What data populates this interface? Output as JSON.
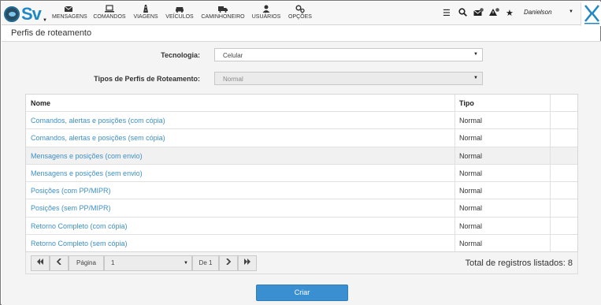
{
  "nav": {
    "items": [
      {
        "label": "MENSAGENS",
        "icon": "envelope-icon"
      },
      {
        "label": "COMANDOS",
        "icon": "laptop-icon"
      },
      {
        "label": "VIAGENS",
        "icon": "road-icon"
      },
      {
        "label": "VEÍCULOS",
        "icon": "car-icon"
      },
      {
        "label": "CAMINHONEIRO",
        "icon": "truck-icon"
      },
      {
        "label": "USUÁRIOS",
        "icon": "user-icon"
      },
      {
        "label": "OPÇÕES",
        "icon": "cogs-icon"
      }
    ],
    "user": "Danielson"
  },
  "page": {
    "title": "Perfis de roteamento"
  },
  "form": {
    "tecnologia_label": "Tecnologia:",
    "tecnologia_value": "Celular",
    "tipos_label": "Tipos de Perfis de Roteamento:",
    "tipos_value": "Normal"
  },
  "table": {
    "columns": [
      "Nome",
      "Tipo"
    ],
    "rows": [
      {
        "nome": "Comandos, alertas e posições (com cópia)",
        "tipo": "Normal"
      },
      {
        "nome": "Comandos, alertas e posições (sem cópia)",
        "tipo": "Normal"
      },
      {
        "nome": "Mensagens e posições (com envio)",
        "tipo": "Normal"
      },
      {
        "nome": "Mensagens e posições (sem envio)",
        "tipo": "Normal"
      },
      {
        "nome": "Posições (com PP/MIPR)",
        "tipo": "Normal"
      },
      {
        "nome": "Posições (sem PP/MIPR)",
        "tipo": "Normal"
      },
      {
        "nome": "Retorno Completo (com cópia)",
        "tipo": "Normal"
      },
      {
        "nome": "Retorno Completo (sem cópia)",
        "tipo": "Normal"
      }
    ]
  },
  "pager": {
    "page_label": "Página",
    "page_value": "1",
    "of_label": "De 1",
    "total": "Total de registros listados: 8"
  },
  "actions": {
    "create": "Criar"
  },
  "colors": {
    "accent": "#3a8fd1",
    "link": "#3d8fc6",
    "brand": "#1f87c5"
  }
}
